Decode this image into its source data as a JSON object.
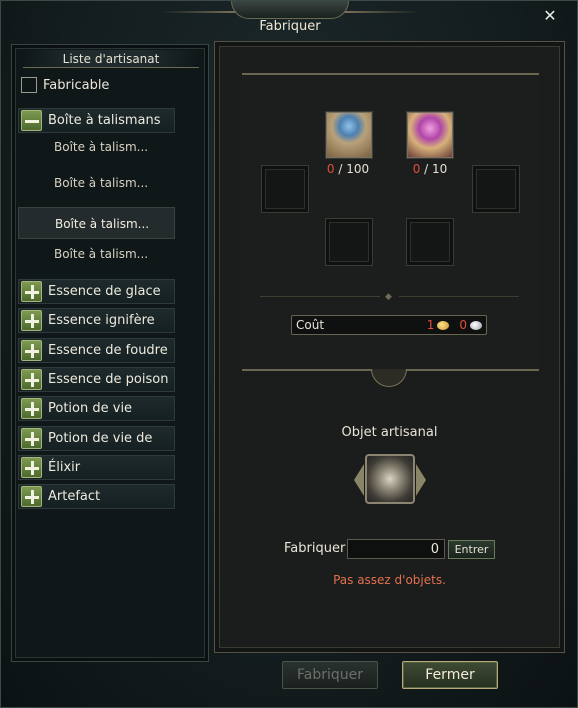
{
  "window": {
    "title": "Fabriquer",
    "close_glyph": "✕"
  },
  "sidebar": {
    "header": "Liste d'artisanat",
    "filter_label": "Fabricable",
    "categories": [
      {
        "label": "Boîte à talismans",
        "expanded": true,
        "items": [
          "Boîte à talism...",
          "Boîte à talism...",
          "Boîte à talism...",
          "Boîte à talism..."
        ],
        "selected_index": 2
      },
      {
        "label": "Essence de glace",
        "expanded": false
      },
      {
        "label": "Essence ignifère",
        "expanded": false
      },
      {
        "label": "Essence de foudre",
        "expanded": false
      },
      {
        "label": "Essence de poison",
        "expanded": false
      },
      {
        "label": "Potion de vie",
        "expanded": false
      },
      {
        "label": "Potion de vie de",
        "expanded": false
      },
      {
        "label": "Élixir",
        "expanded": false
      },
      {
        "label": "Artefact",
        "expanded": false
      }
    ]
  },
  "recipe": {
    "materials": [
      {
        "have": "0",
        "need": "/ 100",
        "icon": "blue-crystal-sack-icon"
      },
      {
        "have": "0",
        "need": "/ 10",
        "icon": "pink-crystal-sack-icon"
      }
    ],
    "cost": {
      "label": "Coût",
      "gold": "1",
      "silver": "0"
    },
    "result_label": "Objet artisanal",
    "result_icon": "talisman-box-icon"
  },
  "craft": {
    "quantity_label": "Fabriquer",
    "quantity_value": "0",
    "enter_label": "Entrer",
    "warning": "Pas assez d'objets."
  },
  "footer": {
    "craft_label": "Fabriquer",
    "close_label": "Fermer"
  },
  "colors": {
    "warning": "#e3704e",
    "shortage": "#e24c3c",
    "category_icon": "#6a8a42"
  }
}
